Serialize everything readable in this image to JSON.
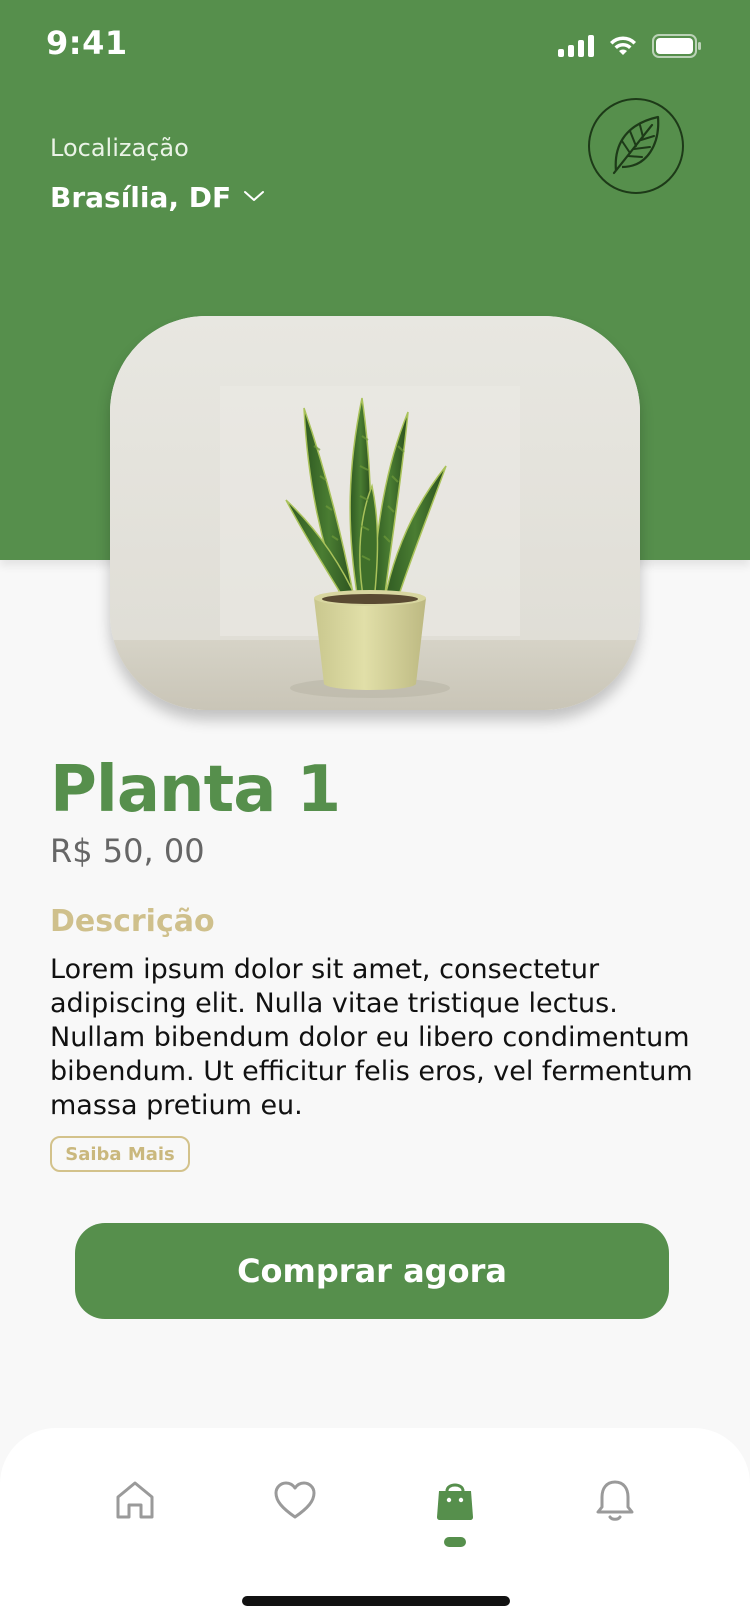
{
  "status_bar": {
    "time": "9:41",
    "icons": [
      "signal-icon",
      "wifi-icon",
      "battery-icon"
    ]
  },
  "header": {
    "location_label": "Localização",
    "location_value": "Brasília, DF",
    "badge_icon": "leaf-icon"
  },
  "product": {
    "image_subject": "snake plant in pot",
    "name": "Planta 1",
    "price": "R$ 50, 00",
    "description_heading": "Descrição",
    "description": "Lorem ipsum dolor sit amet, consectetur adipiscing elit. Nulla vitae  tristique lectus. Nullam bibendum dolor eu libero condimentum bibendum.  Ut efficitur felis eros, vel fermentum massa pretium eu.",
    "learn_more_label": "Saiba Mais",
    "buy_label": "Comprar agora"
  },
  "bottom_nav": {
    "items": [
      {
        "icon": "home-icon",
        "active": false
      },
      {
        "icon": "heart-icon",
        "active": false
      },
      {
        "icon": "shopping-bag-icon",
        "active": true
      },
      {
        "icon": "bell-icon",
        "active": false
      }
    ]
  },
  "colors": {
    "primary": "#568f4c",
    "accent": "#cfc08c",
    "background": "#f8f8f8",
    "nav_inactive": "#9a9a9a"
  }
}
